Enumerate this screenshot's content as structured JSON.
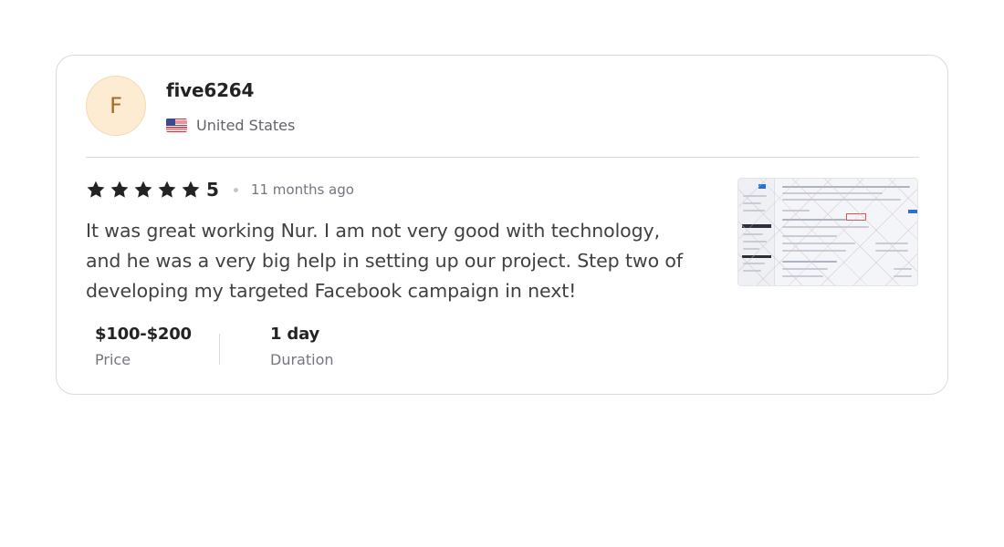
{
  "review": {
    "avatar_initial": "F",
    "reviewer_name": "five6264",
    "country": "United States",
    "rating": {
      "stars": 5,
      "value": "5"
    },
    "time_ago": "11 months ago",
    "text": "It was great working Nur. I am not very good with technology, and he was a very big help in setting up our project. Step two of developing my targeted Facebook campaign in next!",
    "price": {
      "value": "$100-$200",
      "label": "Price"
    },
    "duration": {
      "value": "1 day",
      "label": "Duration"
    }
  },
  "colors": {
    "star": "#222325",
    "avatar_bg": "#fdecd2",
    "avatar_text": "#a76a25",
    "border": "#dadbdd"
  },
  "icons": {
    "star": "star-icon",
    "flag": "us-flag-icon"
  }
}
